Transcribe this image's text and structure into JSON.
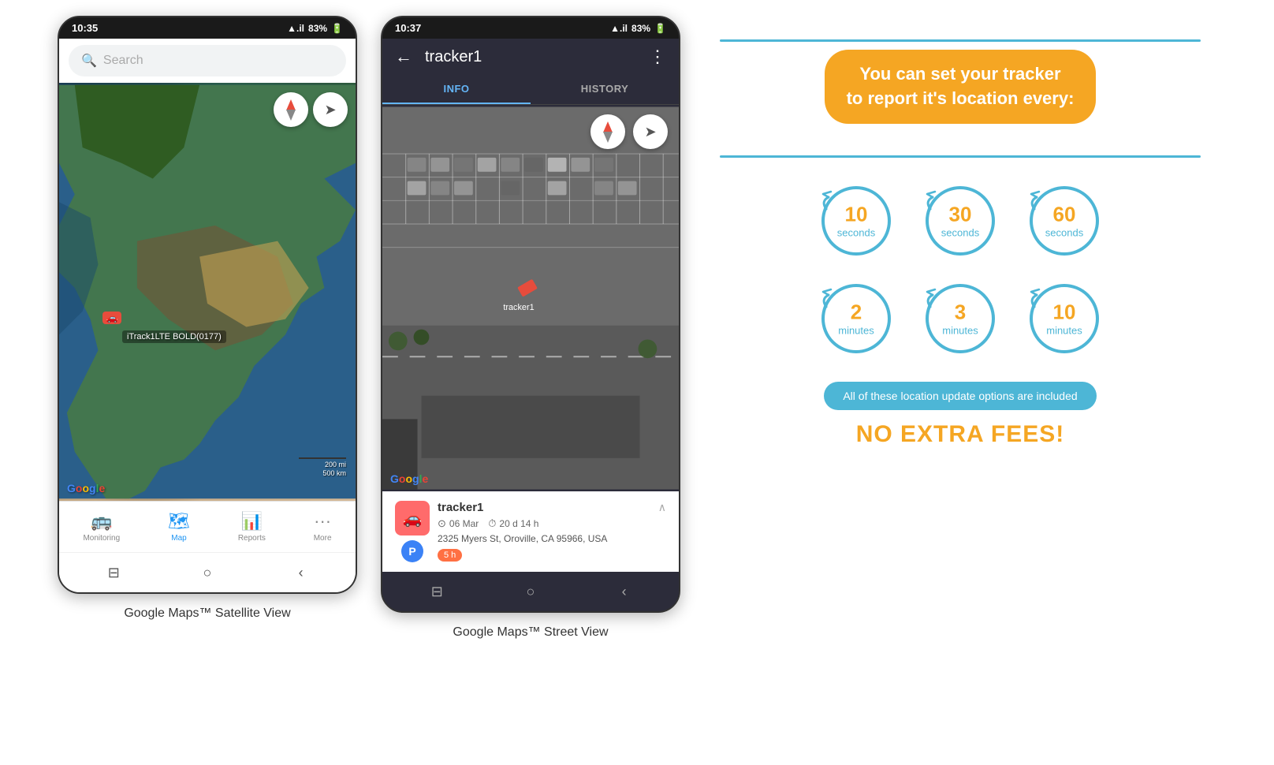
{
  "phone1": {
    "status_time": "10:35",
    "status_signal": "▲.il",
    "status_battery": "83%",
    "search_placeholder": "Search",
    "tracker_label": "iTrack1LTE BOLD(0177)",
    "google_label": "Google",
    "scale_line1": "200 mi",
    "scale_line2": "500 km",
    "nav_items": [
      {
        "label": "Monitoring",
        "icon": "🚌"
      },
      {
        "label": "Map",
        "icon": "🗺",
        "active": true
      },
      {
        "label": "Reports",
        "icon": "📊"
      },
      {
        "label": "More",
        "icon": "···"
      }
    ],
    "caption": "Google Maps™ Satellite View"
  },
  "phone2": {
    "status_time": "10:37",
    "status_signal": "▲.il",
    "status_battery": "83%",
    "tracker_name": "tracker1",
    "tabs": [
      {
        "label": "INFO",
        "active": true
      },
      {
        "label": "HISTORY",
        "active": false
      }
    ],
    "google_label": "Google",
    "tracker1_label": "tracker1",
    "info_panel": {
      "name": "tracker1",
      "date": "06 Mar",
      "duration": "20 d 14 h",
      "address": "2325 Myers St, Oroville, CA 95966, USA",
      "time_badge": "5 h"
    },
    "caption": "Google Maps™ Street View"
  },
  "infographic": {
    "header_line1": "You can set your tracker",
    "header_line2": "to report it's location every:",
    "circles": [
      {
        "number": "10",
        "unit": "seconds"
      },
      {
        "number": "30",
        "unit": "seconds"
      },
      {
        "number": "60",
        "unit": "seconds"
      },
      {
        "number": "2",
        "unit": "minutes"
      },
      {
        "number": "3",
        "unit": "minutes"
      },
      {
        "number": "10",
        "unit": "minutes"
      }
    ],
    "banner_text": "All of these location update options are included",
    "no_fees_text": "NO EXTRA FEES!"
  }
}
